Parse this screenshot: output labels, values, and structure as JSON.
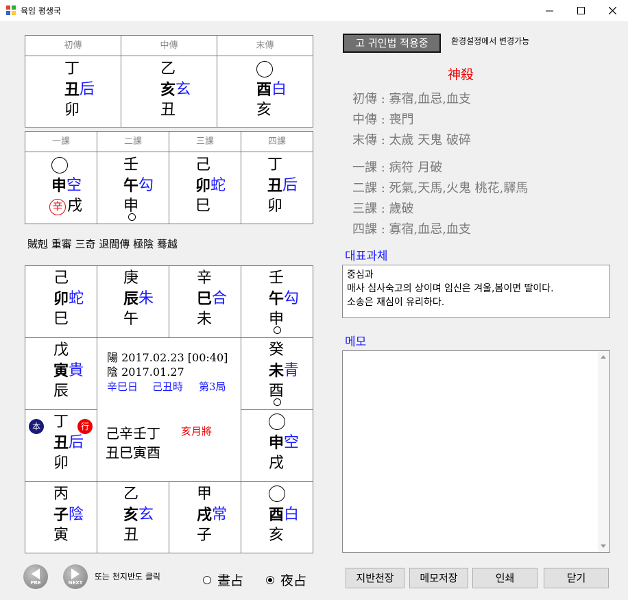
{
  "window": {
    "title": "육임 평생국",
    "minimize_label": "─",
    "maximize_label": "□",
    "close_label": "✕"
  },
  "sanchuan": {
    "headers": [
      "初傳",
      "中傳",
      "末傳"
    ],
    "cells": [
      {
        "stem": "丁",
        "branch": "丑",
        "general": "后",
        "bottom": "卯"
      },
      {
        "stem": "乙",
        "branch": "亥",
        "general": "玄",
        "bottom": "丑"
      },
      {
        "stem": "",
        "branch": "酉",
        "general": "白",
        "bottom": "亥"
      }
    ]
  },
  "sike": {
    "headers": [
      "一課",
      "二課",
      "三課",
      "四課"
    ],
    "cells": [
      {
        "stem": "",
        "branch": "申",
        "general": "空",
        "bottom": "戌",
        "marked": "辛"
      },
      {
        "stem": "壬",
        "branch": "午",
        "general": "勾",
        "bottom": "申"
      },
      {
        "stem": "己",
        "branch": "卯",
        "general": "蛇",
        "bottom": "巳"
      },
      {
        "stem": "丁",
        "branch": "丑",
        "general": "后",
        "bottom": "卯"
      }
    ]
  },
  "gyeok": "賊剋 重審 三奇 退間傳 極陰 蓦越",
  "board": {
    "top": [
      {
        "stem": "己",
        "branch": "卯",
        "general": "蛇",
        "bottom": "巳"
      },
      {
        "stem": "庚",
        "branch": "辰",
        "general": "朱",
        "bottom": "午"
      },
      {
        "stem": "辛",
        "branch": "巳",
        "general": "合",
        "bottom": "未"
      },
      {
        "stem": "壬",
        "branch": "午",
        "general": "勾",
        "bottom": "申"
      }
    ],
    "left": [
      {
        "stem": "戊",
        "branch": "寅",
        "general": "貴",
        "bottom": "辰"
      },
      {
        "stem": "丁",
        "branch": "丑",
        "general": "后",
        "bottom": "卯",
        "badge_left": "本",
        "badge_right": "行"
      }
    ],
    "right": [
      {
        "stem": "癸",
        "branch": "未",
        "general": "青",
        "bottom": "酉"
      },
      {
        "stem": "",
        "branch": "申",
        "general": "空",
        "bottom": "戌"
      }
    ],
    "bottom": [
      {
        "stem": "丙",
        "branch": "子",
        "general": "陰",
        "bottom": "寅"
      },
      {
        "stem": "乙",
        "branch": "亥",
        "general": "玄",
        "bottom": "丑"
      },
      {
        "stem": "甲",
        "branch": "戌",
        "general": "常",
        "bottom": "子"
      },
      {
        "stem": "",
        "branch": "酉",
        "general": "白",
        "bottom": "亥"
      }
    ],
    "center": {
      "solar": "陽 2017.02.23 [00:40]",
      "lunar": "陰 2017.01.27",
      "day": "辛巳日",
      "hour": "己丑時",
      "ju": "第3局",
      "stems_row": "己辛壬丁",
      "branches_row": "丑巳寅酉",
      "month_general": "亥月將"
    }
  },
  "nav": {
    "prev_label": "PRE",
    "next_label": "NEXT",
    "hint": "또는 천지반도 클릭",
    "radio_day": "晝占",
    "radio_night": "夜占",
    "selected": "night"
  },
  "right_panel": {
    "mode_button": "고 귀인법 적용중",
    "mode_note": "환경설정에서 변경가능",
    "sinsal_title": "神殺",
    "sinsal_lines": [
      "初傳 :  寡宿,血忌,血支",
      "中傳 : 喪門",
      "末傳 : 太歲 天鬼 破碎",
      "一課 : 病符 月破",
      "二課 :  死氣,天馬,火鬼 桃花,驛馬",
      "三課 : 歲破",
      "四課 :  寡宿,血忌,血支"
    ],
    "repr_label": "대표과체",
    "repr_lines": [
      "중심과",
      "매사 심사숙고의 상이며 임신은 겨울,봄이면 딸이다.",
      "소송은 재심이 유리하다."
    ],
    "memo_label": "메모",
    "memo_value": ""
  },
  "buttons": {
    "jiban": "지반천장",
    "memo_save": "메모저장",
    "print": "인쇄",
    "close": "닫기"
  },
  "colors": {
    "general_blue": "#1a1aff",
    "sinsal_red": "#ee0000",
    "badge_navy": "#1a1a7a"
  }
}
